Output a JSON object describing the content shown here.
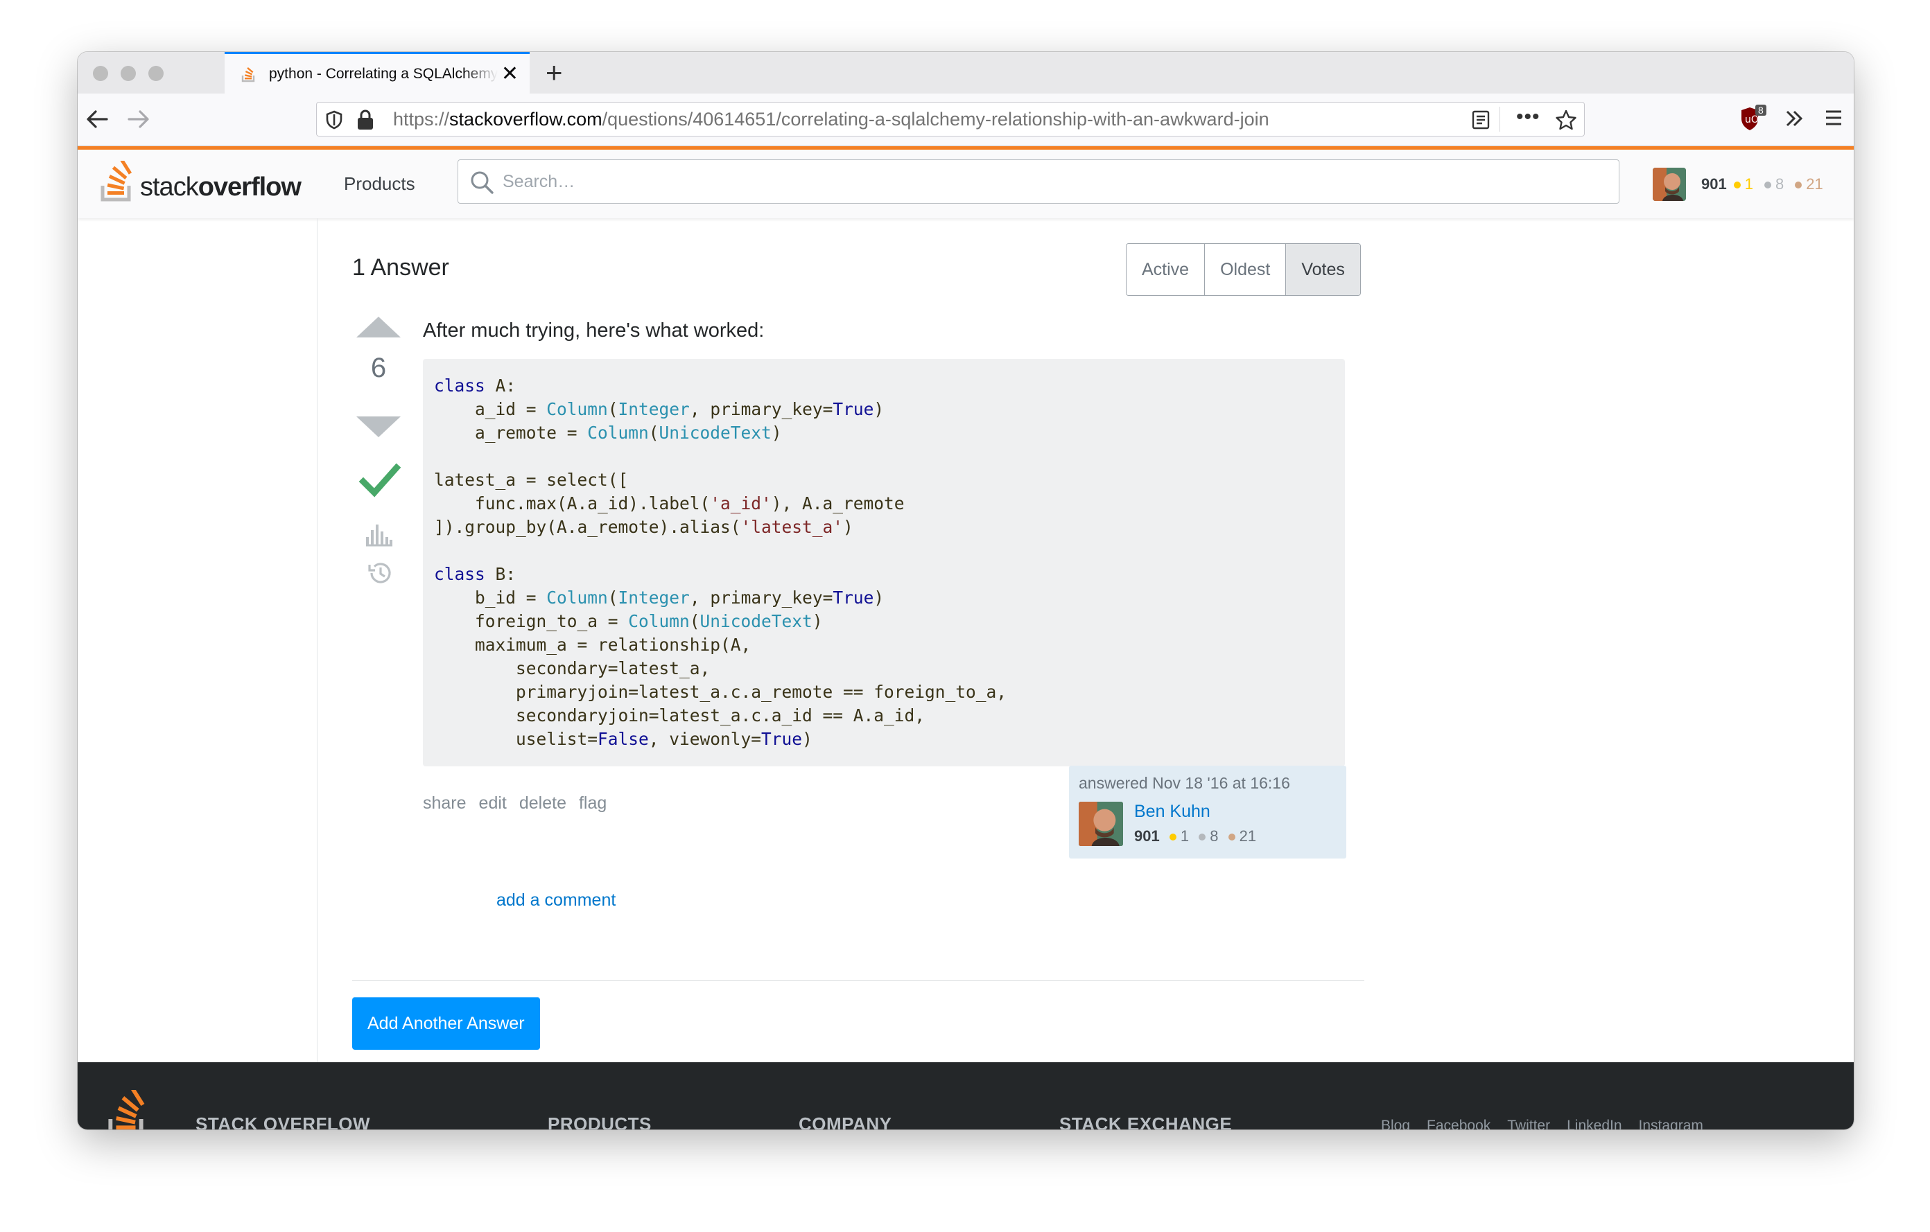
{
  "browser": {
    "tab_title": "python - Correlating a SQLAlchemy relationship with an awkward join",
    "url_prefix": "https://",
    "url_host": "stackoverflow.com",
    "url_path": "/questions/40614651/correlating-a-sqlalchemy-relationship-with-an-awkward-join",
    "ublock_count": "8"
  },
  "header": {
    "logo_light": "stack",
    "logo_bold": "overflow",
    "products": "Products",
    "search_placeholder": "Search…",
    "user": {
      "reputation": "901",
      "gold": "1",
      "silver": "8",
      "bronze": "21"
    }
  },
  "answers": {
    "count_label": "1 Answer",
    "sort_tabs": [
      "Active",
      "Oldest",
      "Votes"
    ],
    "selected_sort": "Votes"
  },
  "answer": {
    "votes": "6",
    "accepted": true,
    "text": "After much trying, here's what worked:",
    "menu": [
      "share",
      "edit",
      "delete",
      "flag"
    ],
    "signature": {
      "action": "answered Nov 18 '16 at 16:16",
      "name": "Ben Kuhn",
      "reputation": "901",
      "gold": "1",
      "silver": "8",
      "bronze": "21"
    },
    "add_comment": "add a comment"
  },
  "add_answer_button": "Add Another Answer",
  "footer": {
    "columns": [
      "STACK OVERFLOW",
      "PRODUCTS",
      "COMPANY",
      "STACK EXCHANGE"
    ],
    "social": [
      "Blog",
      "Facebook",
      "Twitter",
      "LinkedIn",
      "Instagram"
    ]
  },
  "colors": {
    "accent_orange": "#f48024",
    "link_blue": "#0077cc",
    "button_blue": "#0095ff",
    "accepted_green": "#48a868"
  },
  "icons": [
    "back-arrow-icon",
    "forward-arrow-icon",
    "shield-icon",
    "lock-icon",
    "reader-icon",
    "more-icon",
    "star-icon",
    "ublock-icon",
    "overflow-chevron-icon",
    "hamburger-icon",
    "search-icon",
    "checkmark-icon",
    "bounty-icon",
    "history-icon"
  ]
}
